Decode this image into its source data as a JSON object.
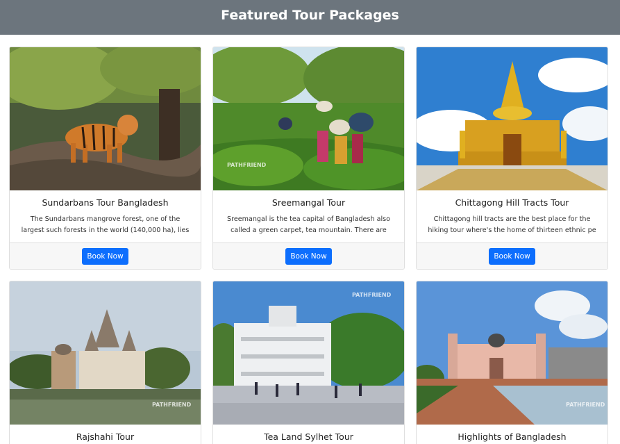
{
  "header": {
    "title": "Featured Tour Packages"
  },
  "packages": [
    {
      "title": "Sundarbans Tour Bangladesh",
      "description": "The Sundarbans mangrove forest, one of the largest such forests in the world (140,000 ha), lies on t",
      "button_label": "Book Now"
    },
    {
      "title": "Sreemangal Tour",
      "description": "Sreemangal is the tea capital of Bangladesh also called a green carpet, tea mountain. There are over",
      "button_label": "Book Now"
    },
    {
      "title": "Chittagong Hill Tracts Tour",
      "description": "Chittagong hill tracts are the best place for the hiking tour where's the home of thirteen ethnic pe",
      "button_label": "Book Now"
    },
    {
      "title": "Rajshahi Tour"
    },
    {
      "title": "Tea Land Sylhet Tour"
    },
    {
      "title": "Highlights of Bangladesh"
    }
  ],
  "watermark": "PATHFRIEND",
  "colors": {
    "header_bg": "#6c757d",
    "button_bg": "#0d6efd"
  }
}
